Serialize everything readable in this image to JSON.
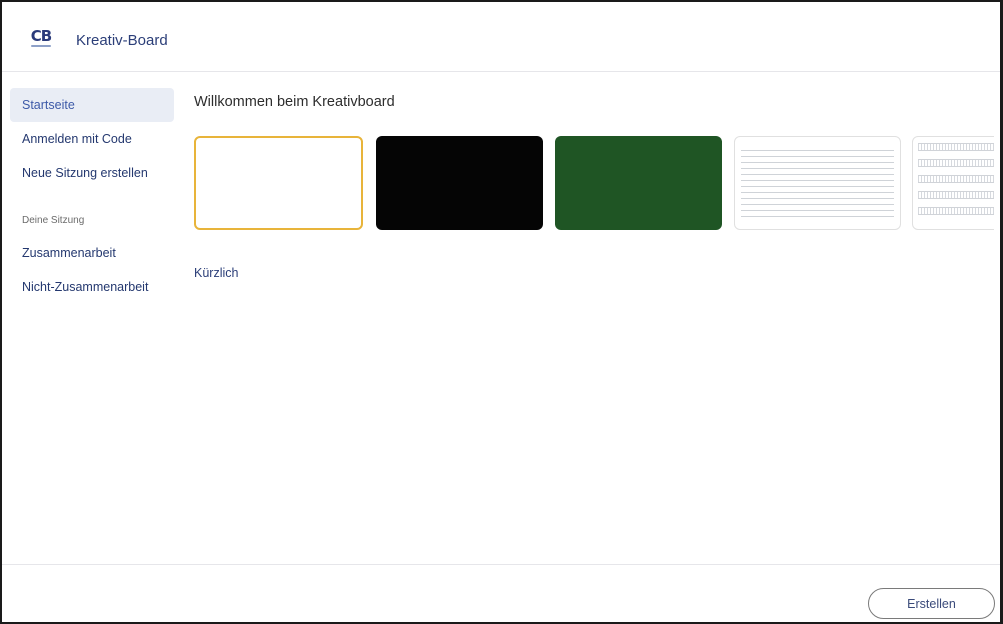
{
  "header": {
    "logo_text": "CB",
    "app_title": "Kreativ-Board"
  },
  "sidebar": {
    "items": [
      {
        "label": "Startseite",
        "active": true
      },
      {
        "label": "Anmelden mit Code"
      },
      {
        "label": "Neue Sitzung erstellen"
      }
    ],
    "section_label": "Deine Sitzung",
    "session_items": [
      {
        "label": "Zusammenarbeit"
      },
      {
        "label": "Nicht-Zusammenarbeit"
      }
    ]
  },
  "main": {
    "welcome_title": "Willkommen beim Kreativboard",
    "templates": [
      {
        "name": "white",
        "color": "#ffffff",
        "selected": true,
        "selected_border": "#e8b43a"
      },
      {
        "name": "black",
        "color": "#050505"
      },
      {
        "name": "green",
        "color": "#1f5524"
      },
      {
        "name": "lined",
        "color": "#ffffff"
      },
      {
        "name": "grid",
        "color": "#ffffff"
      }
    ],
    "recent_label": "Kürzlich"
  },
  "footer": {
    "create_label": "Erstellen"
  },
  "colors": {
    "accent": "#2b3e78",
    "active_bg": "#e9edf5",
    "selected_border": "#e8b43a"
  }
}
